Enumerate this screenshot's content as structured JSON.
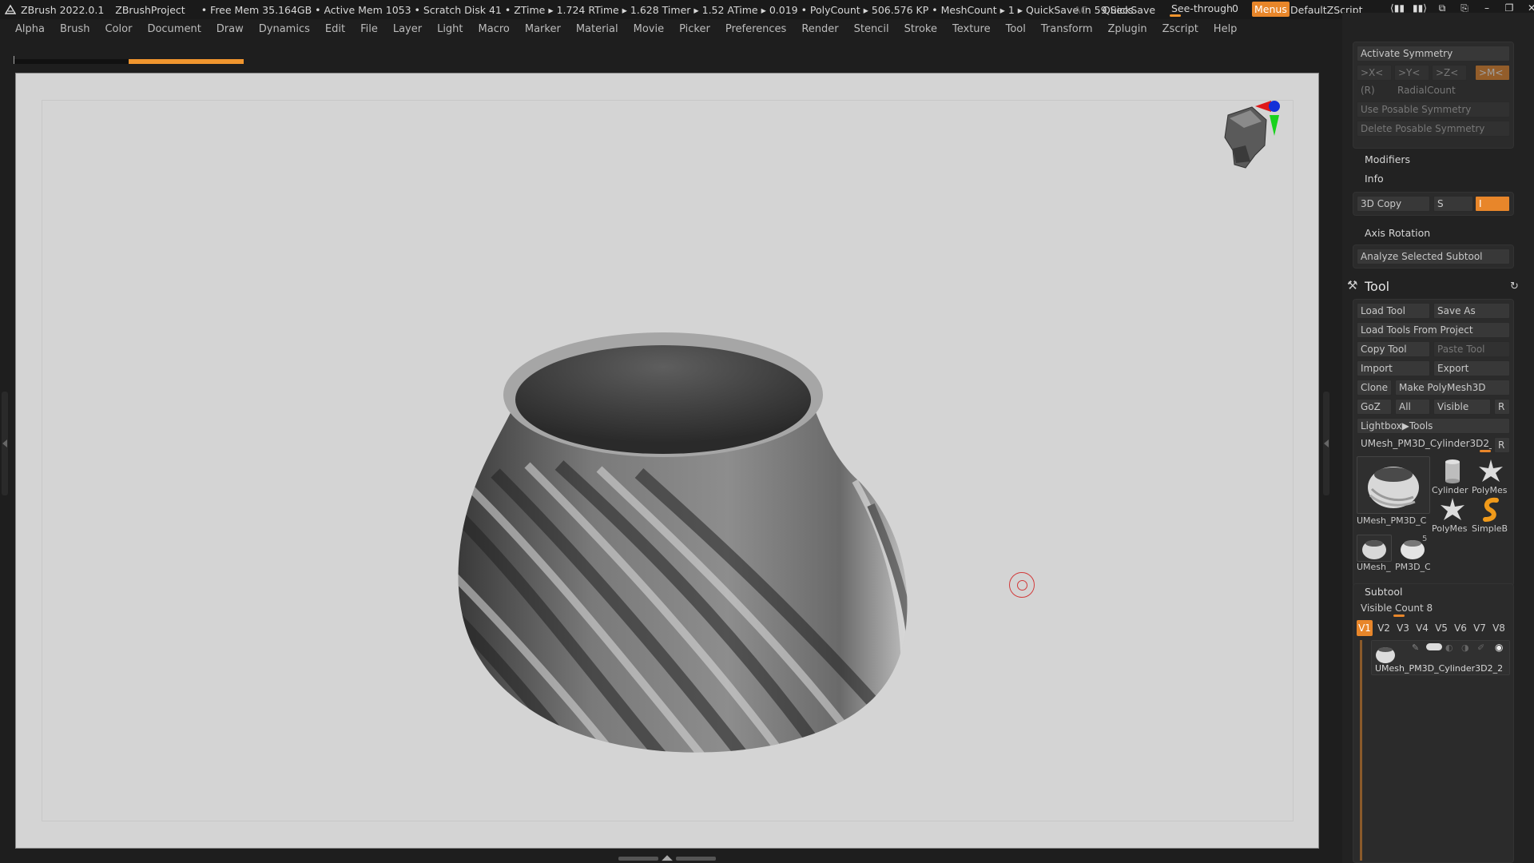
{
  "titlebar": {
    "app_name": "ZBrush 2022.0.1",
    "project": "ZBrushProject",
    "stats": "• Free Mem 35.164GB • Active Mem 1053 • Scratch Disk 41 •  ZTime ▸ 1.724 RTime ▸ 1.628 Timer ▸ 1.52 ATime ▸ 0.019 • PolyCount ▸ 506.576 KP  • MeshCount ▸ 1  ▸ QuickSave In 59 Secs",
    "ac": "AC",
    "quicksave": "QuickSave",
    "see_through_label": "See-through",
    "see_through_value": "0",
    "see_through_level": 0.0,
    "menus_label": "Menus",
    "default_zscript": "DefaultZScript"
  },
  "menubar": [
    "Alpha",
    "Brush",
    "Color",
    "Document",
    "Draw",
    "Dynamics",
    "Edit",
    "File",
    "Layer",
    "Light",
    "Macro",
    "Marker",
    "Material",
    "Movie",
    "Picker",
    "Preferences",
    "Render",
    "Stencil",
    "Stroke",
    "Texture",
    "Tool",
    "Transform",
    "Zplugin",
    "Zscript",
    "Help"
  ],
  "symmetry": {
    "activate": "Activate Symmetry",
    "x": ">X<",
    "y": ">Y<",
    "z": ">Z<",
    "m": ">M<",
    "r": "(R)",
    "radial": "RadialCount",
    "posable": "Use Posable Symmetry",
    "delete_posable": "Delete Posable Symmetry"
  },
  "transform_sections": {
    "modifiers": "Modifiers",
    "info": "Info",
    "copy3d": "3D Copy",
    "copy3d_s": "S",
    "copy3d_i": "I",
    "axis_rotation": "Axis Rotation",
    "analyze": "Analyze Selected Subtool"
  },
  "tool": {
    "title": "Tool",
    "load_tool": "Load Tool",
    "save_as": "Save As",
    "load_from_project": "Load Tools From Project",
    "copy_tool": "Copy Tool",
    "paste_tool": "Paste Tool",
    "import": "Import",
    "export": "Export",
    "clone": "Clone",
    "make_polymesh": "Make PolyMesh3D",
    "goz": "GoZ",
    "all": "All",
    "visible": "Visible",
    "r": "R",
    "lightbox": "Lightbox▶Tools",
    "current_tool": "UMesh_PM3D_Cylinder3D2_2",
    "current_r": "R",
    "thumbs": [
      {
        "label": "UMesh_PM3D_C"
      },
      {
        "label": "Cylinder"
      },
      {
        "label": "PolyMes"
      },
      {
        "label": "PolyMes"
      },
      {
        "label": "SimpleB"
      },
      {
        "label": "UMesh_"
      },
      {
        "label": "PM3D_C"
      }
    ],
    "thumb_badge": "5"
  },
  "subtool": {
    "title": "Subtool",
    "visible_count": "Visible Count 8",
    "tabs": [
      "V1",
      "V2",
      "V3",
      "V4",
      "V5",
      "V6",
      "V7",
      "V8"
    ],
    "item_label": "UMesh_PM3D_Cylinder3D2_2"
  },
  "colors": {
    "accent": "#e8862a",
    "viewport_bg": "#d4d4d4",
    "panel_bg": "#222222"
  }
}
